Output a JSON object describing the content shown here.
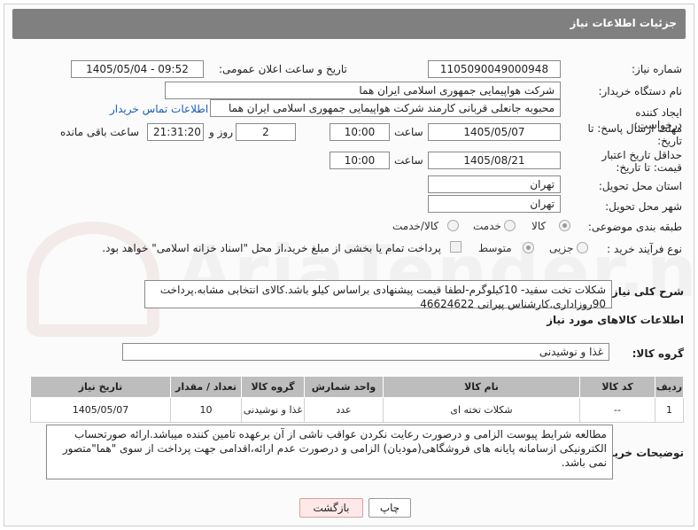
{
  "header": {
    "title": "جزئیات اطلاعات نیاز"
  },
  "fields": {
    "need_number": {
      "label": "شماره نیاز:",
      "value": "1105090049000948"
    },
    "announce_datetime": {
      "label": "تاریخ و ساعت اعلان عمومی:",
      "value": "1405/05/04 - 09:52"
    },
    "buyer_org": {
      "label": "نام دستگاه خریدار:",
      "value": "شرکت هواپیمایی جمهوری اسلامی ایران هما"
    },
    "requester": {
      "label": "ایجاد کننده درخواست:",
      "value": "محبوبه جانعلی قربانی کارمند شرکت هواپیمایی جمهوری اسلامی ایران هما",
      "contact_link": "اطلاعات تماس خریدار"
    },
    "reply_deadline": {
      "label": "مهلت ارسال پاسخ: تا تاریخ:",
      "date": "1405/05/07",
      "time_label": "ساعت",
      "time": "10:00",
      "days": "2",
      "days_label": "روز و",
      "remaining": "21:31:20",
      "remaining_label": "ساعت باقی مانده"
    },
    "price_validity": {
      "label": "حداقل تاریخ اعتبار قیمت: تا تاریخ:",
      "date": "1405/08/21",
      "time_label": "ساعت",
      "time": "10:00"
    },
    "delivery_province": {
      "label": "استان محل تحویل:",
      "value": "تهران"
    },
    "delivery_city": {
      "label": "شهر محل تحویل:",
      "value": "تهران"
    },
    "category": {
      "label": "طبقه بندی موضوعی:",
      "options": [
        "کالا",
        "خدمت",
        "کالا/خدمت"
      ],
      "selected": "کالا"
    },
    "purchase_type": {
      "label": "نوع فرآیند خرید :",
      "options": [
        "جزیی",
        "متوسط"
      ],
      "selected": "متوسط",
      "payment_note": "پرداخت تمام یا بخشی از مبلغ خرید،از محل \"اسناد خزانه اسلامی\" خواهد بود."
    }
  },
  "general_desc": {
    "label": "شرح کلی نیاز:",
    "text": "شکلات تخت سفید- 10کیلوگرم-لطفا قیمت پیشنهادی براساس کیلو باشد.کالای انتخابی مشابه.پرداخت 90روزاداری.کارشناس پیرانی 46624622"
  },
  "goods_info": {
    "title": "اطلاعات کالاهای مورد نیاز",
    "group_label": "گروه کالا:",
    "group_value": "غذا و نوشیدنی"
  },
  "table": {
    "headers": [
      "ردیف",
      "کد کالا",
      "نام کالا",
      "واحد شمارش",
      "گروه کالا",
      "تعداد / مقدار",
      "تاریخ نیاز"
    ],
    "rows": [
      [
        "1",
        "--",
        "شکلات تخته ای",
        "عدد",
        "غذا و نوشیدنی",
        "10",
        "1405/05/07"
      ]
    ]
  },
  "buyer_notes": {
    "label": "توضیحات خریدار:",
    "text": "مطالعه شرایط پیوست الزامی و درصورت رعایت نکردن عواقب ناشی از آن برعهده تامین کننده میباشد.ارائه صورتحساب الکترونیکی ازسامانه پایانه های فروشگاهی(مودیان) الزامی و درصورت عدم ارائه،اقدامی جهت پرداخت از سوی \"هما\"متصور نمی باشد."
  },
  "buttons": {
    "print": "چاپ",
    "back": "بازگشت"
  },
  "watermark": {
    "text": "AriaTender.neT"
  }
}
